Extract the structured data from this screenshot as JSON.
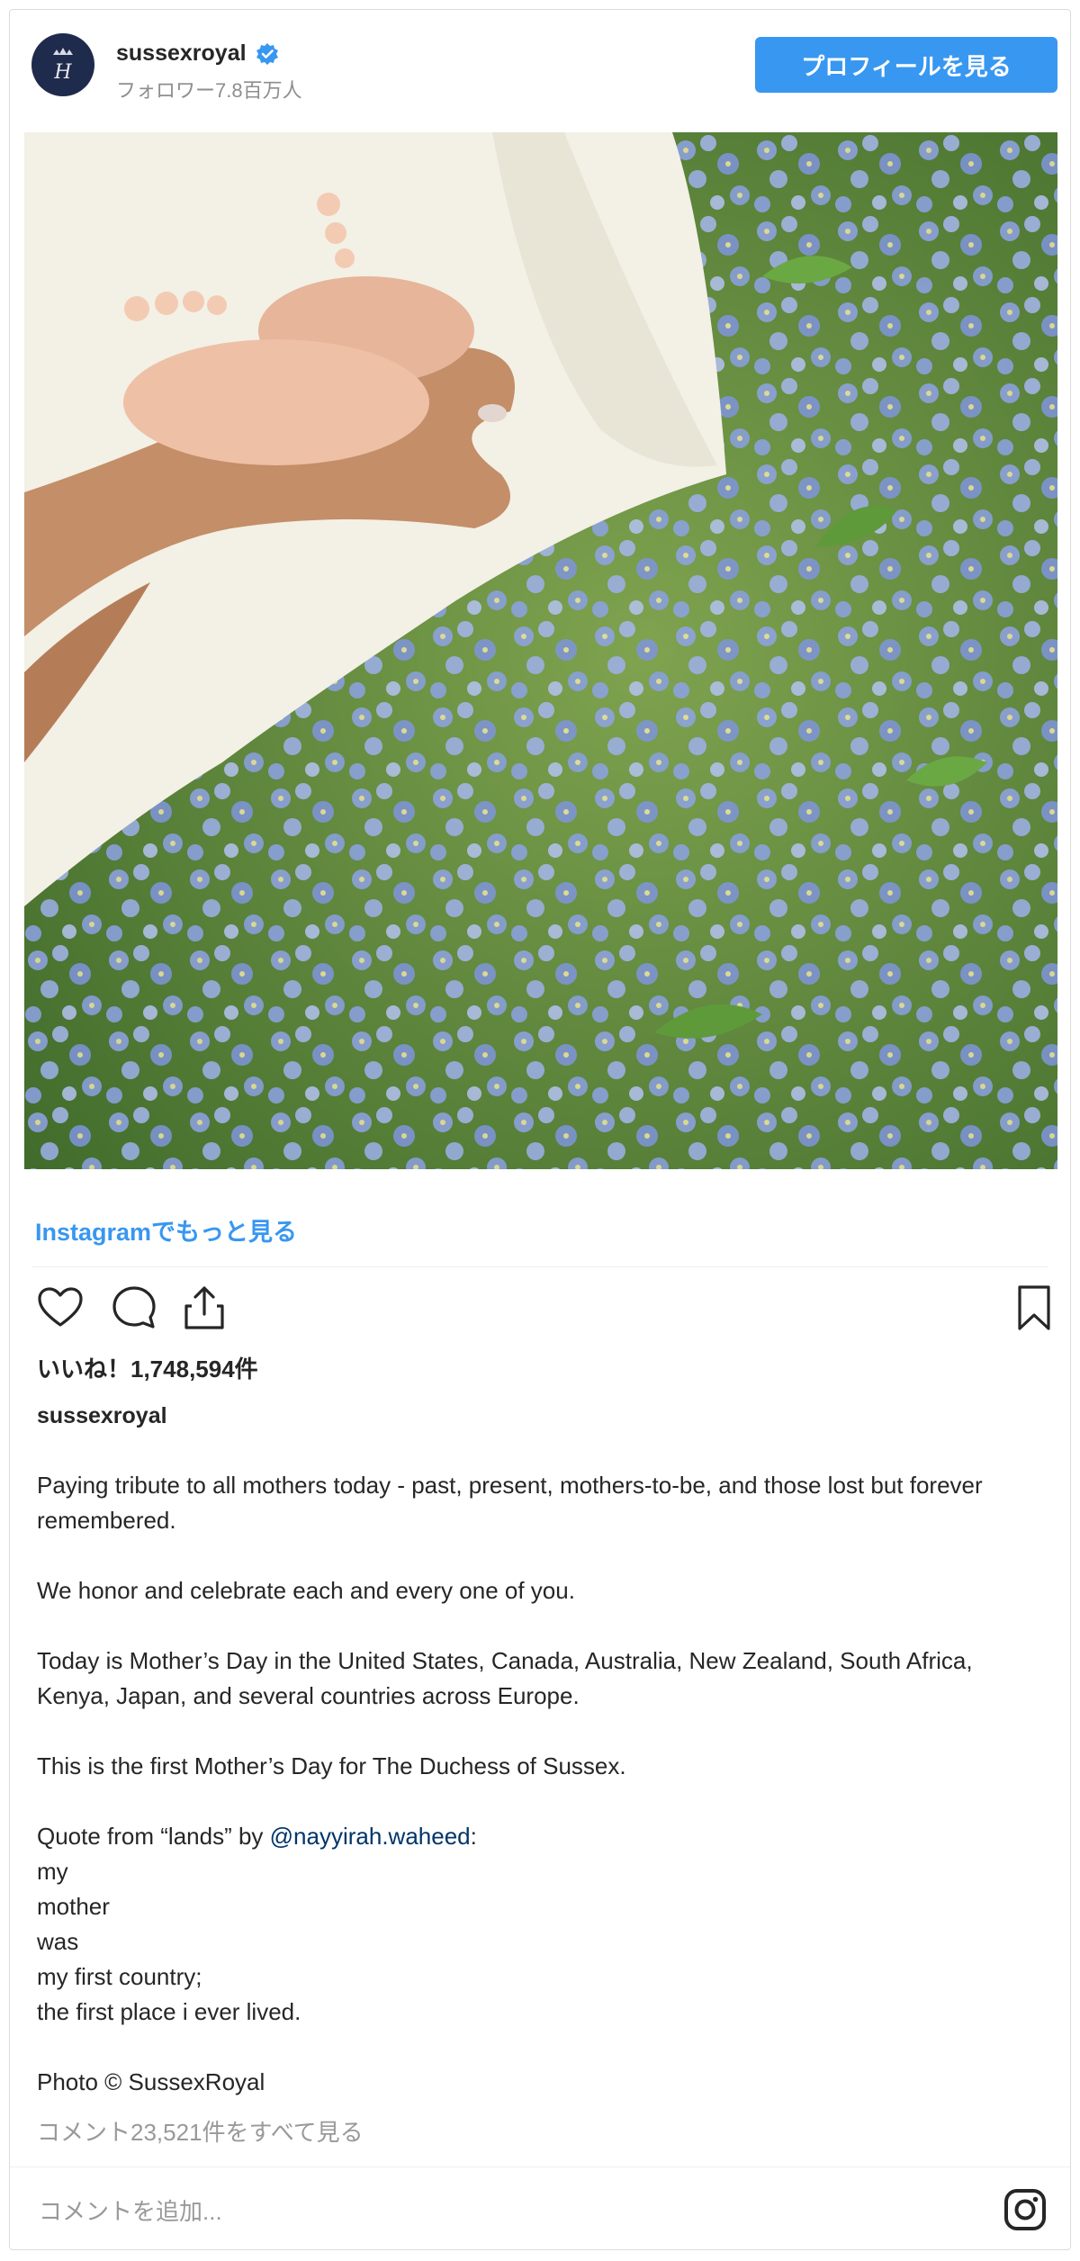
{
  "header": {
    "username": "sussexroyal",
    "verified_icon": "verified-badge-icon",
    "followers": "フォロワー7.8百万人",
    "profile_button": "プロフィールを見る",
    "avatar_monogram": "H"
  },
  "main": {
    "more_link": "Instagramでもっと見る",
    "likes": "いいね！1,748,594件",
    "caption_username": "sussexroyal",
    "caption": {
      "p1": "Paying tribute to all mothers today - past, present, mothers-to-be, and those lost but forever remembered.",
      "p2": "We honor and celebrate each and every one of you.",
      "p3": "Today is Mother’s Day in the United States, Canada, Australia, New Zealand, South Africa, Kenya, Japan, and several countries across Europe.",
      "p4": "This is the first Mother’s Day for The Duchess of Sussex.",
      "quote_prefix": "Quote from “lands” by ",
      "mention": "@nayyirah.waheed",
      "quote_suffix": ":",
      "poem": [
        "my",
        "mother",
        "was",
        "my first country;",
        "the first place i ever lived."
      ],
      "credit": "Photo © SussexRoyal"
    },
    "view_comments": "コメント23,521件をすべて見る"
  },
  "footer": {
    "comment_placeholder": "コメントを追加..."
  },
  "icons": [
    "heart-icon",
    "comment-icon",
    "share-icon",
    "bookmark-icon",
    "instagram-icon"
  ],
  "colors": {
    "accent": "#3897f0",
    "text": "#262626",
    "muted": "#8e8e8e",
    "mention": "#003569"
  }
}
